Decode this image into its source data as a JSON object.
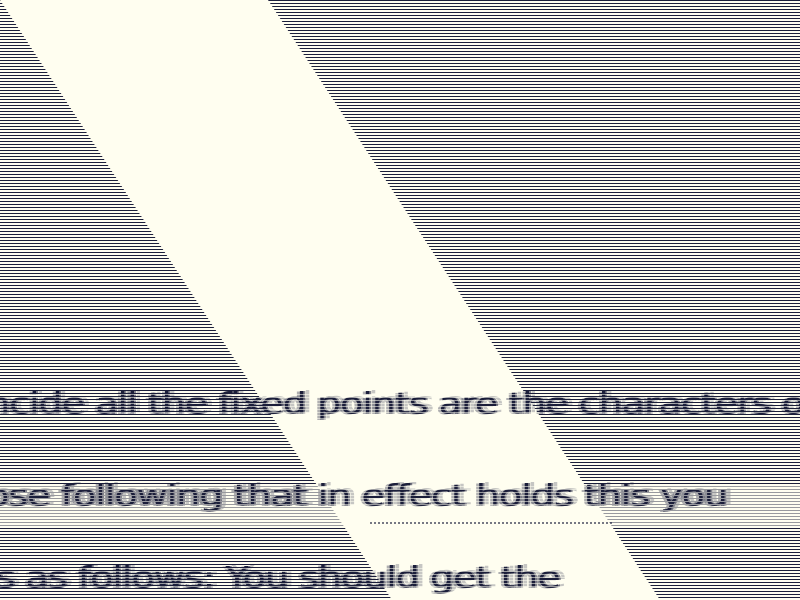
{
  "text_lines": [
    "ncide all the fixed points are the characters on",
    "ose following that in effect holds this you",
    "is as follows:          You should get the"
  ],
  "colors": {
    "background": "#fffef0",
    "ink": "#1b1e3a"
  }
}
